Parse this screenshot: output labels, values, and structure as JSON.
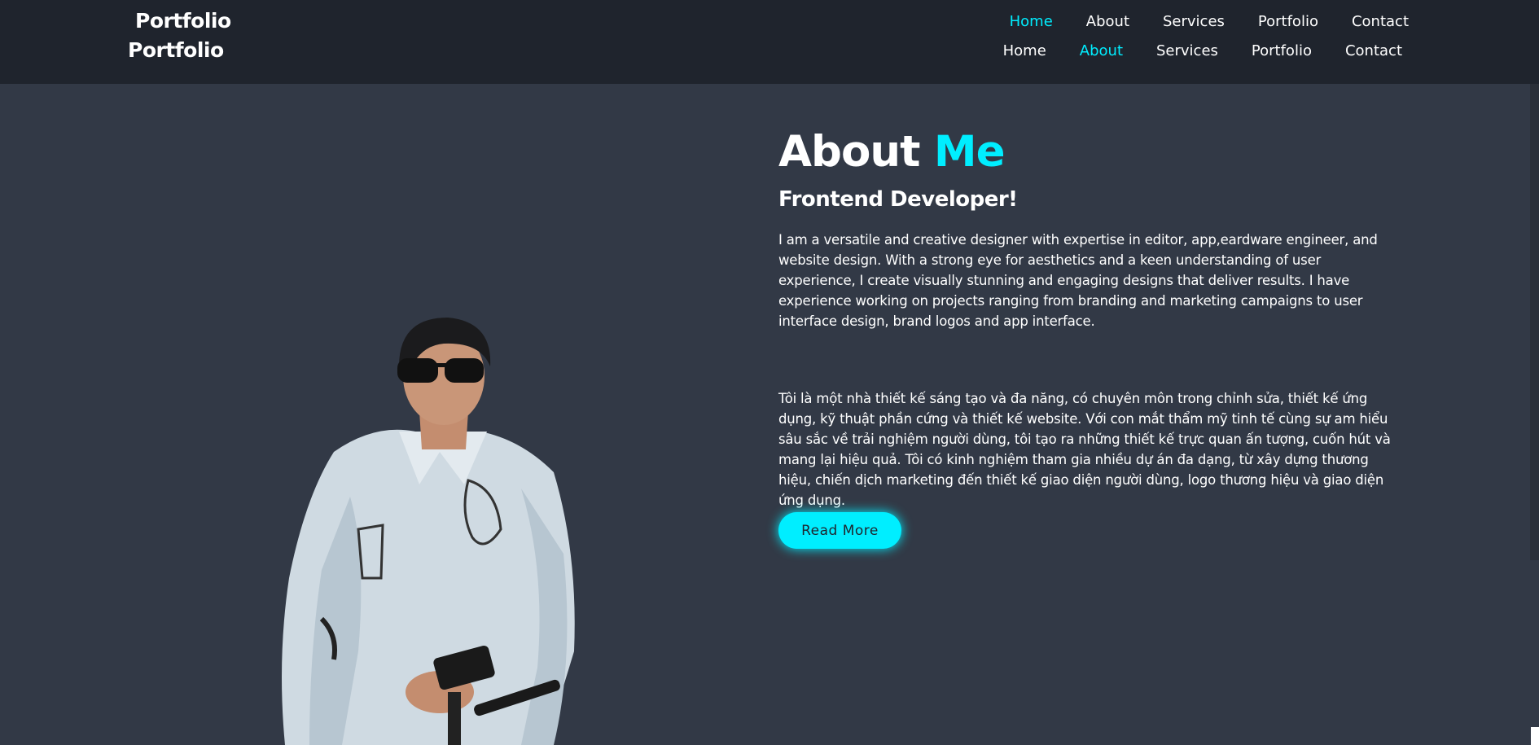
{
  "header": {
    "logo_primary": "Portfolio",
    "logo_secondary": "Portfolio",
    "nav_primary": [
      {
        "label": "Home",
        "active": true
      },
      {
        "label": "About",
        "active": false
      },
      {
        "label": "Services",
        "active": false
      },
      {
        "label": "Portfolio",
        "active": false
      },
      {
        "label": "Contact",
        "active": false
      }
    ],
    "nav_secondary": [
      {
        "label": "Home",
        "active": false
      },
      {
        "label": "About",
        "active": true
      },
      {
        "label": "Services",
        "active": false
      },
      {
        "label": "Portfolio",
        "active": false
      },
      {
        "label": "Contact",
        "active": false
      }
    ]
  },
  "about": {
    "title_main": "About",
    "title_accent": "Me",
    "subtitle": "Frontend Developer!",
    "paragraph_en": "I am a versatile and creative designer with expertise in editor, app,eardware engineer, and website design. With a strong eye for aesthetics and a keen understanding of user experience, I create visually stunning and engaging designs that deliver results. I have experience working on projects ranging from branding and marketing campaigns to user interface design, brand logos and app interface.",
    "paragraph_vi": "Tôi là một nhà thiết kế sáng tạo và đa năng, có chuyên môn trong chỉnh sửa, thiết kế ứng dụng, kỹ thuật phần cứng và thiết kế website. Với con mắt thẩm mỹ tinh tế cùng sự am hiểu sâu sắc về trải nghiệm người dùng, tôi tạo ra những thiết kế trực quan ấn tượng, cuốn hút và mang lại hiệu quả. Tôi có kinh nghiệm tham gia nhiều dự án đa dạng, từ xây dựng thương hiệu, chiến dịch marketing đến thiết kế giao diện người dùng, logo thương hiệu và giao diện ứng dụng.",
    "read_more_label": "Read More"
  },
  "colors": {
    "accent": "#00eeff",
    "background": "#323946",
    "header_bg": "#1f242d",
    "text": "#ffffff"
  }
}
